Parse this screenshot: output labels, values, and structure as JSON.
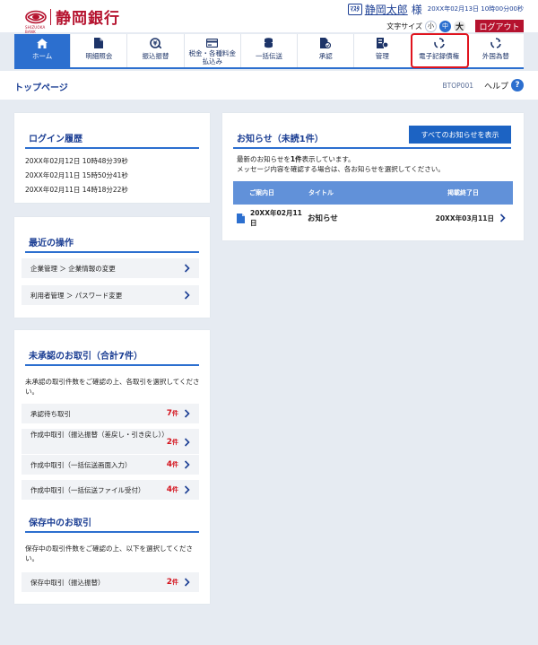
{
  "brand": {
    "name": "静岡銀行",
    "sub": "SHIZUOKA BANK",
    "color": "#b5122e"
  },
  "user": {
    "badge": "ﾏｽﾀ",
    "name": "静岡太郎",
    "honorific": "様",
    "last_login": "20XX年02月13日 10時00分00秒",
    "font_size_label": "文字サイズ",
    "font_sizes": [
      "小",
      "中",
      "大"
    ],
    "font_size_selected": "中",
    "logout_label": "ログアウト"
  },
  "nav": {
    "items": [
      {
        "label": "ホーム",
        "icon": "home-icon",
        "active": true
      },
      {
        "label": "明細照会",
        "icon": "document-icon"
      },
      {
        "label": "振込振替",
        "icon": "transfer-icon"
      },
      {
        "label": "税金・各種料金\n払込み",
        "icon": "payment-card-icon"
      },
      {
        "label": "一括伝送",
        "icon": "coins-icon"
      },
      {
        "label": "承認",
        "icon": "approval-icon"
      },
      {
        "label": "管理",
        "icon": "admin-icon"
      },
      {
        "label": "電子記録債権",
        "icon": "cycle-icon",
        "highlighted": true
      },
      {
        "label": "外国為替",
        "icon": "cycle-icon"
      }
    ],
    "accent": "#2c6fcf",
    "highlight_color": "#e0141e"
  },
  "page": {
    "title": "トップページ",
    "code": "BTOP001",
    "help_label": "ヘルプ",
    "help_icon": "?"
  },
  "login_history": {
    "title": "ログイン履歴",
    "entries": [
      "20XX年02月12日 10時48分39秒",
      "20XX年02月11日 15時50分41秒",
      "20XX年02月11日 14時18分22秒"
    ]
  },
  "recent_ops": {
    "title": "最近の操作",
    "items": [
      "企業管理 ＞ 企業情報の変更",
      "利用者管理 ＞ パスワード変更"
    ]
  },
  "pending": {
    "title": "未承認のお取引（合計7件）",
    "description": "未承認の取引件数をご確認の上、各取引を選択してください。",
    "items": [
      {
        "label": "承認待ち取引",
        "count": "7",
        "unit": "件"
      },
      {
        "label": "作成中取引（振込振替（差戻し・引き戻し））",
        "count": "2",
        "unit": "件"
      },
      {
        "label": "作成中取引（一括伝送画面入力）",
        "count": "4",
        "unit": "件"
      },
      {
        "label": "作成中取引（一括伝送ファイル受付）",
        "count": "4",
        "unit": "件"
      }
    ]
  },
  "saved": {
    "title": "保存中のお取引",
    "description": "保存中の取引件数をご確認の上、以下を選択してください。",
    "items": [
      {
        "label": "保存中取引（振込振替）",
        "count": "2",
        "unit": "件"
      }
    ]
  },
  "news": {
    "title": "お知らせ（未読1件）",
    "all_button": "すべてのお知らせを表示",
    "desc_line1_pre": "最新のお知らせを",
    "desc_line1_bold": "1件",
    "desc_line1_post": "表示しています。",
    "desc_line2": "メッセージ内容を確認する場合は、各お知らせを選択してください。",
    "columns": [
      "ご案内日",
      "タイトル",
      "掲載終了日"
    ],
    "rows": [
      {
        "date": "20XX年02月11日",
        "title": "お知らせ",
        "end": "20XX年03月11日"
      }
    ]
  }
}
